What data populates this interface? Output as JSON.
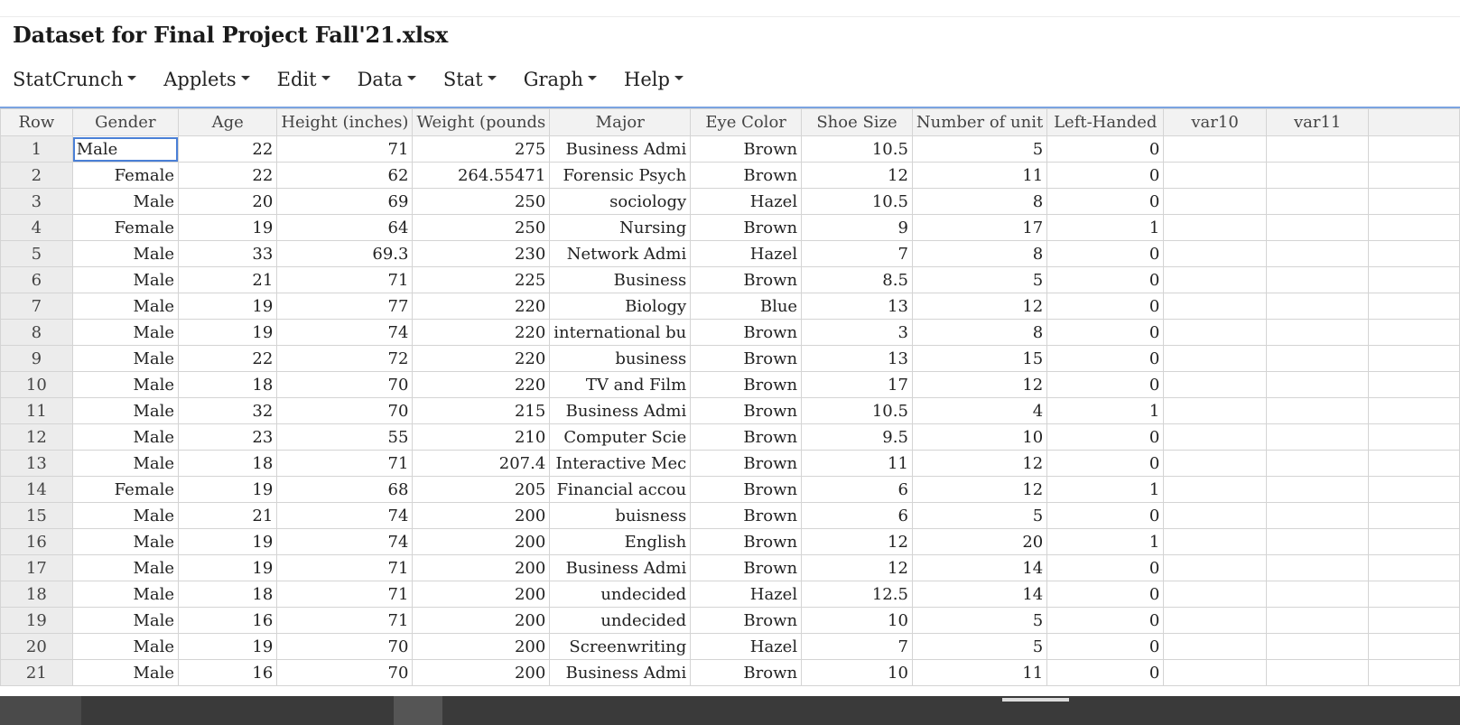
{
  "title": "Dataset for Final Project Fall'21.xlsx",
  "menu": [
    "StatCrunch",
    "Applets",
    "Edit",
    "Data",
    "Stat",
    "Graph",
    "Help"
  ],
  "columns": [
    "Row",
    "Gender",
    "Age",
    "Height (inches)",
    "Weight (pounds",
    "Major",
    "Eye Color",
    "Shoe Size",
    "Number of unit",
    "Left-Handed",
    "var10",
    "var11",
    ""
  ],
  "rows": [
    [
      "1",
      "Male",
      "22",
      "71",
      "275",
      "Business Admi",
      "Brown",
      "10.5",
      "5",
      "0",
      "",
      "",
      ""
    ],
    [
      "2",
      "Female",
      "22",
      "62",
      "264.55471",
      "Forensic Psych",
      "Brown",
      "12",
      "11",
      "0",
      "",
      "",
      ""
    ],
    [
      "3",
      "Male",
      "20",
      "69",
      "250",
      "sociology",
      "Hazel",
      "10.5",
      "8",
      "0",
      "",
      "",
      ""
    ],
    [
      "4",
      "Female",
      "19",
      "64",
      "250",
      "Nursing",
      "Brown",
      "9",
      "17",
      "1",
      "",
      "",
      ""
    ],
    [
      "5",
      "Male",
      "33",
      "69.3",
      "230",
      "Network Admi",
      "Hazel",
      "7",
      "8",
      "0",
      "",
      "",
      ""
    ],
    [
      "6",
      "Male",
      "21",
      "71",
      "225",
      "Business",
      "Brown",
      "8.5",
      "5",
      "0",
      "",
      "",
      ""
    ],
    [
      "7",
      "Male",
      "19",
      "77",
      "220",
      "Biology",
      "Blue",
      "13",
      "12",
      "0",
      "",
      "",
      ""
    ],
    [
      "8",
      "Male",
      "19",
      "74",
      "220",
      "international bu",
      "Brown",
      "3",
      "8",
      "0",
      "",
      "",
      ""
    ],
    [
      "9",
      "Male",
      "22",
      "72",
      "220",
      "business",
      "Brown",
      "13",
      "15",
      "0",
      "",
      "",
      ""
    ],
    [
      "10",
      "Male",
      "18",
      "70",
      "220",
      "TV and Film",
      "Brown",
      "17",
      "12",
      "0",
      "",
      "",
      ""
    ],
    [
      "11",
      "Male",
      "32",
      "70",
      "215",
      "Business Admi",
      "Brown",
      "10.5",
      "4",
      "1",
      "",
      "",
      ""
    ],
    [
      "12",
      "Male",
      "23",
      "55",
      "210",
      "Computer Scie",
      "Brown",
      "9.5",
      "10",
      "0",
      "",
      "",
      ""
    ],
    [
      "13",
      "Male",
      "18",
      "71",
      "207.4",
      "Interactive Mec",
      "Brown",
      "11",
      "12",
      "0",
      "",
      "",
      ""
    ],
    [
      "14",
      "Female",
      "19",
      "68",
      "205",
      "Financial accou",
      "Brown",
      "6",
      "12",
      "1",
      "",
      "",
      ""
    ],
    [
      "15",
      "Male",
      "21",
      "74",
      "200",
      "buisness",
      "Brown",
      "6",
      "5",
      "0",
      "",
      "",
      ""
    ],
    [
      "16",
      "Male",
      "19",
      "74",
      "200",
      "English",
      "Brown",
      "12",
      "20",
      "1",
      "",
      "",
      ""
    ],
    [
      "17",
      "Male",
      "19",
      "71",
      "200",
      "Business Admi",
      "Brown",
      "12",
      "14",
      "0",
      "",
      "",
      ""
    ],
    [
      "18",
      "Male",
      "18",
      "71",
      "200",
      "undecided",
      "Hazel",
      "12.5",
      "14",
      "0",
      "",
      "",
      ""
    ],
    [
      "19",
      "Male",
      "16",
      "71",
      "200",
      "undecided",
      "Brown",
      "10",
      "5",
      "0",
      "",
      "",
      ""
    ],
    [
      "20",
      "Male",
      "19",
      "70",
      "200",
      "Screenwriting",
      "Hazel",
      "7",
      "5",
      "0",
      "",
      "",
      ""
    ],
    [
      "21",
      "Male",
      "16",
      "70",
      "200",
      "Business Admi",
      "Brown",
      "10",
      "11",
      "0",
      "",
      "",
      ""
    ]
  ]
}
